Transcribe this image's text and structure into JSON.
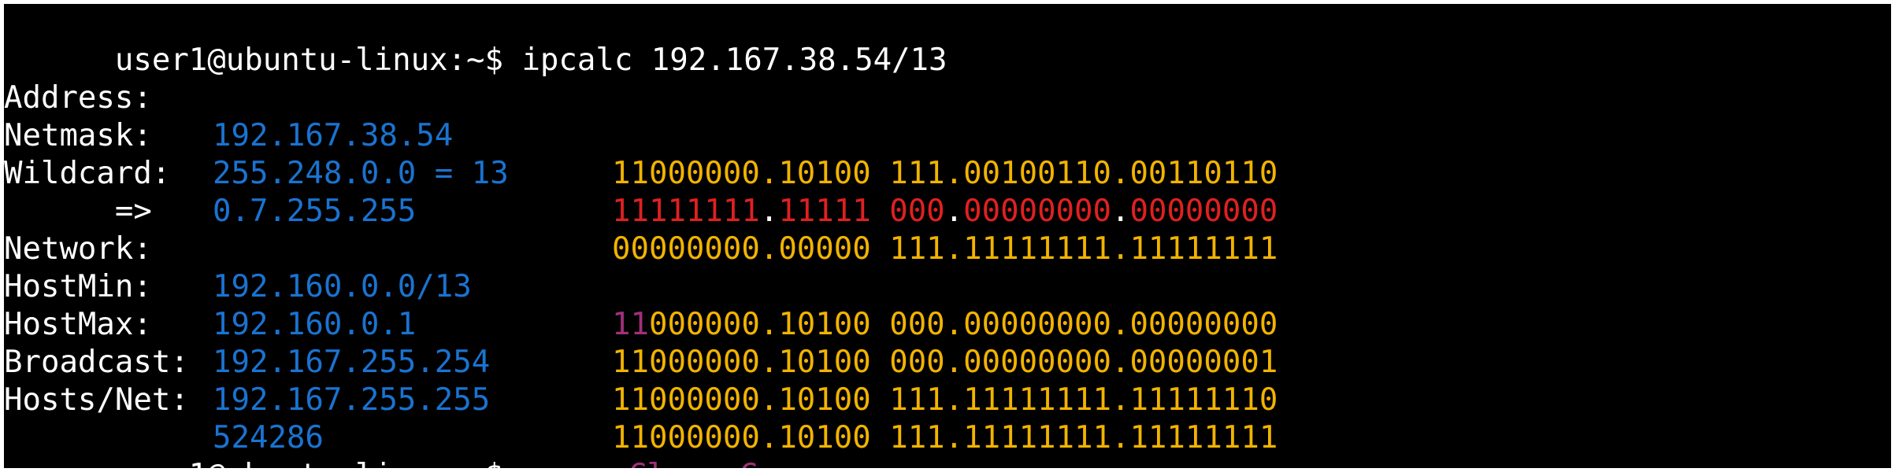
{
  "terminal": {
    "command_line": "user1@ubuntu-linux:~$ ipcalc 192.167.38.54/13",
    "prompt_end": "user1@ubuntu-linux:~$",
    "colors": {
      "background": "#000000",
      "text": "#ffffff",
      "value": "#1a73d1",
      "bits": "#f2b300",
      "mask_bits": "#e02020",
      "class": "#a0307a"
    },
    "rows": {
      "address": {
        "label": "Address:",
        "value": "192.167.38.54",
        "bits_net": "11000000.10100",
        "bits_host": " 111.00100110.00110110"
      },
      "netmask": {
        "label": "Netmask:",
        "value": "255.248.0.0 = 13",
        "bits_a": "11111111",
        "dot1": ".",
        "bits_b": "11111",
        "sp": " ",
        "bits_c": "000",
        "dot2": ".",
        "bits_d": "00000000",
        "dot3": ".",
        "bits_e": "00000000"
      },
      "wildcard": {
        "label": "Wildcard:",
        "value": "0.7.255.255",
        "bits_net": "00000000.00000",
        "bits_host": " 111.11111111.11111111"
      },
      "arrow": "=>",
      "network": {
        "label": "Network:",
        "value": "192.160.0.0/13",
        "bits_class": "11",
        "bits_net": "000000.10100",
        "bits_host": " 000.00000000.00000000"
      },
      "hostmin": {
        "label": "HostMin:",
        "value": "192.160.0.1",
        "bits_net": "11000000.10100",
        "bits_host": " 000.00000000.00000001"
      },
      "hostmax": {
        "label": "HostMax:",
        "value": "192.167.255.254",
        "bits_net": "11000000.10100",
        "bits_host": " 111.11111111.11111110"
      },
      "broadcast": {
        "label": "Broadcast:",
        "value": "192.167.255.255",
        "bits_net": "11000000.10100",
        "bits_host": " 111.11111111.11111111"
      },
      "hosts": {
        "label": "Hosts/Net:",
        "value": "524286",
        "class_text": "Class C"
      }
    }
  }
}
